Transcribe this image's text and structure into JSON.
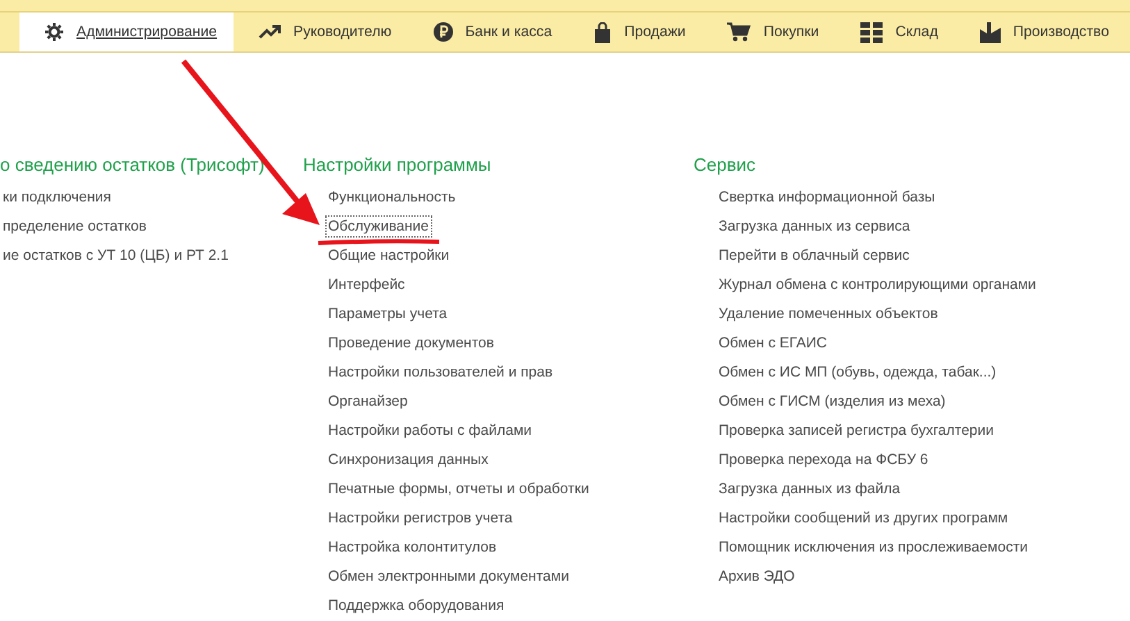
{
  "sections_bar": {
    "tabs": [
      {
        "label": "Администрирование",
        "selected": true
      },
      {
        "label": "Руководителю",
        "selected": false
      },
      {
        "label": "Банк и касса",
        "selected": false
      },
      {
        "label": "Продажи",
        "selected": false
      },
      {
        "label": "Покупки",
        "selected": false
      },
      {
        "label": "Склад",
        "selected": false
      },
      {
        "label": "Производство",
        "selected": false
      }
    ]
  },
  "columns": [
    {
      "title": "о сведению остатков (Трисофт)",
      "items": [
        {
          "label": "ки подключения",
          "selected": false
        },
        {
          "label": "пределение остатков",
          "selected": false
        },
        {
          "label": "ие остатков с УТ 10 (ЦБ) и РТ 2.1",
          "selected": false
        }
      ]
    },
    {
      "title": "Настройки программы",
      "items": [
        {
          "label": "Функциональность",
          "selected": false
        },
        {
          "label": "Обслуживание",
          "selected": true
        },
        {
          "label": "Общие настройки",
          "selected": false
        },
        {
          "label": "Интерфейс",
          "selected": false
        },
        {
          "label": "Параметры учета",
          "selected": false
        },
        {
          "label": "Проведение документов",
          "selected": false
        },
        {
          "label": "Настройки пользователей и прав",
          "selected": false
        },
        {
          "label": "Органайзер",
          "selected": false
        },
        {
          "label": "Настройки работы с файлами",
          "selected": false
        },
        {
          "label": "Синхронизация данных",
          "selected": false
        },
        {
          "label": "Печатные формы, отчеты и обработки",
          "selected": false
        },
        {
          "label": "Настройки регистров учета",
          "selected": false
        },
        {
          "label": "Настройка колонтитулов",
          "selected": false
        },
        {
          "label": "Обмен электронными документами",
          "selected": false
        },
        {
          "label": "Поддержка оборудования",
          "selected": false
        }
      ]
    },
    {
      "title": "Сервис",
      "items": [
        {
          "label": "Свертка информационной базы",
          "selected": false
        },
        {
          "label": "Загрузка данных из сервиса",
          "selected": false
        },
        {
          "label": "Перейти в облачный сервис",
          "selected": false
        },
        {
          "label": "Журнал обмена с контролирующими органами",
          "selected": false
        },
        {
          "label": "Удаление помеченных объектов",
          "selected": false
        },
        {
          "label": "Обмен с ЕГАИС",
          "selected": false
        },
        {
          "label": "Обмен с ИС МП (обувь, одежда, табак...)",
          "selected": false
        },
        {
          "label": "Обмен с ГИСМ (изделия из меха)",
          "selected": false
        },
        {
          "label": "Проверка записей регистра бухгалтерии",
          "selected": false
        },
        {
          "label": "Проверка перехода на ФСБУ 6",
          "selected": false
        },
        {
          "label": "Загрузка данных из файла",
          "selected": false
        },
        {
          "label": "Настройки сообщений из других программ",
          "selected": false
        },
        {
          "label": "Помощник исключения из прослеживаемости",
          "selected": false
        },
        {
          "label": "Архив ЭДО",
          "selected": false
        }
      ]
    }
  ]
}
